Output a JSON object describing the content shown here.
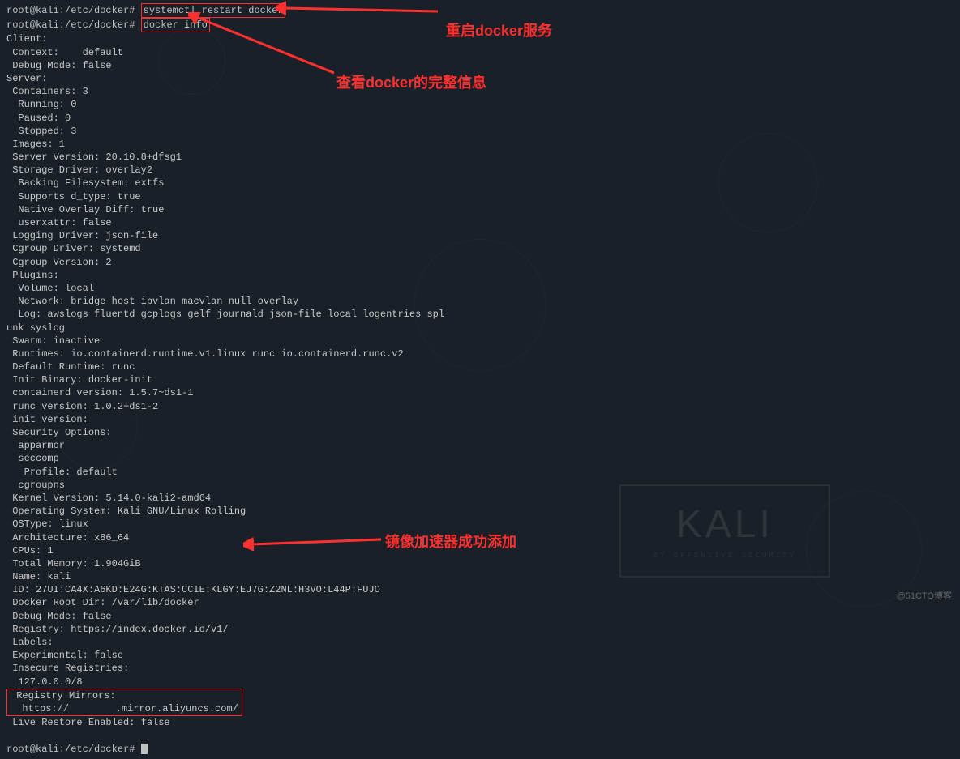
{
  "prompt1": {
    "prefix": "root@kali:/etc/docker# ",
    "command": "systemctl restart docker"
  },
  "prompt2": {
    "prefix": "root@kali:/etc/docker# ",
    "command": "docker info"
  },
  "prompt3": {
    "prefix": "root@kali:/etc/docker# "
  },
  "annotations": {
    "restart": "重启docker服务",
    "info": "查看docker的完整信息",
    "mirror": "镜像加速器成功添加"
  },
  "output": {
    "client_header": "Client:",
    "context": " Context:    default",
    "debug_mode": " Debug Mode: false",
    "blank1": "",
    "server_header": "Server:",
    "containers": " Containers: 3",
    "running": "  Running: 0",
    "paused": "  Paused: 0",
    "stopped": "  Stopped: 3",
    "images": " Images: 1",
    "server_version": " Server Version: 20.10.8+dfsg1",
    "storage_driver": " Storage Driver: overlay2",
    "backing_fs": "  Backing Filesystem: extfs",
    "supports_dtype": "  Supports d_type: true",
    "native_overlay": "  Native Overlay Diff: true",
    "userxattr": "  userxattr: false",
    "logging_driver": " Logging Driver: json-file",
    "cgroup_driver": " Cgroup Driver: systemd",
    "cgroup_version": " Cgroup Version: 2",
    "plugins": " Plugins:",
    "volume": "  Volume: local",
    "network": "  Network: bridge host ipvlan macvlan null overlay",
    "log": "  Log: awslogs fluentd gcplogs gelf journald json-file local logentries spl",
    "log2": "unk syslog",
    "swarm": " Swarm: inactive",
    "runtimes": " Runtimes: io.containerd.runtime.v1.linux runc io.containerd.runc.v2",
    "default_runtime": " Default Runtime: runc",
    "init_binary": " Init Binary: docker-init",
    "containerd_version": " containerd version: 1.5.7~ds1-1",
    "runc_version": " runc version: 1.0.2+ds1-2",
    "init_version": " init version:",
    "security_options": " Security Options:",
    "apparmor": "  apparmor",
    "seccomp": "  seccomp",
    "profile": "   Profile: default",
    "cgroupns": "  cgroupns",
    "kernel_version": " Kernel Version: 5.14.0-kali2-amd64",
    "operating_system": " Operating System: Kali GNU/Linux Rolling",
    "ostype": " OSType: linux",
    "architecture": " Architecture: x86_64",
    "cpus": " CPUs: 1",
    "total_memory": " Total Memory: 1.904GiB",
    "name": " Name: kali",
    "id": " ID: 27UI:CA4X:A6KD:E24G:KTAS:CCIE:KLGY:EJ7G:Z2NL:H3VO:L44P:FUJO",
    "docker_root": " Docker Root Dir: /var/lib/docker",
    "debug_mode2": " Debug Mode: false",
    "registry": " Registry: https://index.docker.io/v1/",
    "labels": " Labels:",
    "experimental": " Experimental: false",
    "insecure_registries": " Insecure Registries:",
    "insecure_addr": "  127.0.0.0/8",
    "registry_mirrors": " Registry Mirrors:",
    "mirror_url": "  https://        .mirror.aliyuncs.com/",
    "live_restore": " Live Restore Enabled: false",
    "blank2": ""
  },
  "logo": {
    "title": "KALI",
    "subtitle": "BY OFFENSIVE SECURITY"
  },
  "cto_watermark": "@51CTO博客"
}
